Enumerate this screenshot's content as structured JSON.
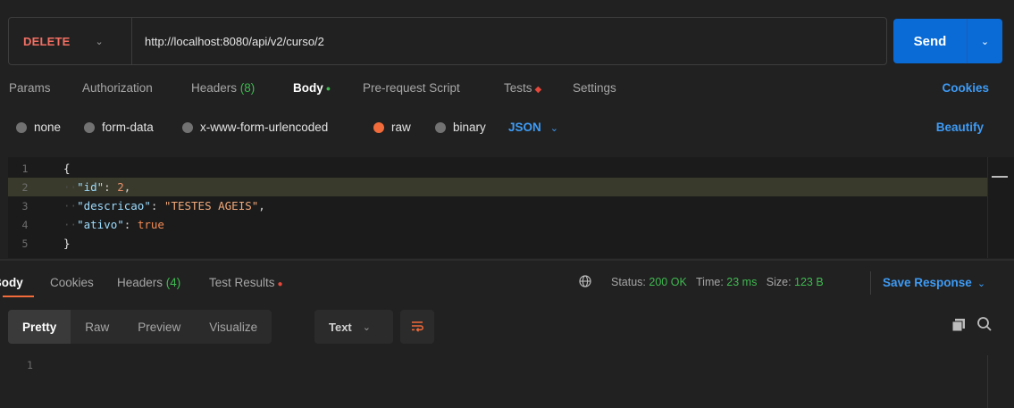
{
  "request": {
    "method": "DELETE",
    "url": "http://localhost:8080/api/v2/curso/2",
    "send_label": "Send"
  },
  "request_tabs": {
    "params": "Params",
    "authorization": "Authorization",
    "headers_label": "Headers",
    "headers_count": "(8)",
    "body": "Body",
    "pre_request": "Pre-request Script",
    "tests": "Tests",
    "settings": "Settings",
    "cookies": "Cookies"
  },
  "body_types": {
    "options": [
      "none",
      "form-data",
      "x-www-form-urlencoded",
      "raw",
      "binary"
    ],
    "selected": "raw",
    "format": "JSON",
    "beautify": "Beautify"
  },
  "editor": {
    "line_numbers": [
      "1",
      "2",
      "3",
      "4",
      "5"
    ],
    "open_brace": "{",
    "close_brace": "}",
    "fields": [
      {
        "key": "\"id\"",
        "value": "2"
      },
      {
        "key": "\"descricao\"",
        "value": "\"TESTES AGEIS\""
      },
      {
        "key": "\"ativo\"",
        "value": "true"
      }
    ]
  },
  "response_tabs": {
    "body": "Body",
    "cookies": "Cookies",
    "headers_label": "Headers",
    "headers_count": "(4)",
    "test_results": "Test Results"
  },
  "response_status": {
    "status_label": "Status:",
    "status_value": "200 OK",
    "time_label": "Time:",
    "time_value": "23 ms",
    "size_label": "Size:",
    "size_value": "123 B",
    "save_response": "Save Response"
  },
  "response_view": {
    "modes": [
      "Pretty",
      "Raw",
      "Preview",
      "Visualize"
    ],
    "active_mode": "Pretty",
    "text_format": "Text",
    "line_numbers": [
      "1"
    ]
  },
  "colors": {
    "accent_blue": "#0a6bd6",
    "method_red": "#f36f63",
    "success_green": "#3fb950",
    "active_orange": "#f26b3a"
  },
  "icons": [
    "chevron-down-icon",
    "globe-icon",
    "wrap-lines-icon",
    "copy-icon",
    "search-icon"
  ]
}
